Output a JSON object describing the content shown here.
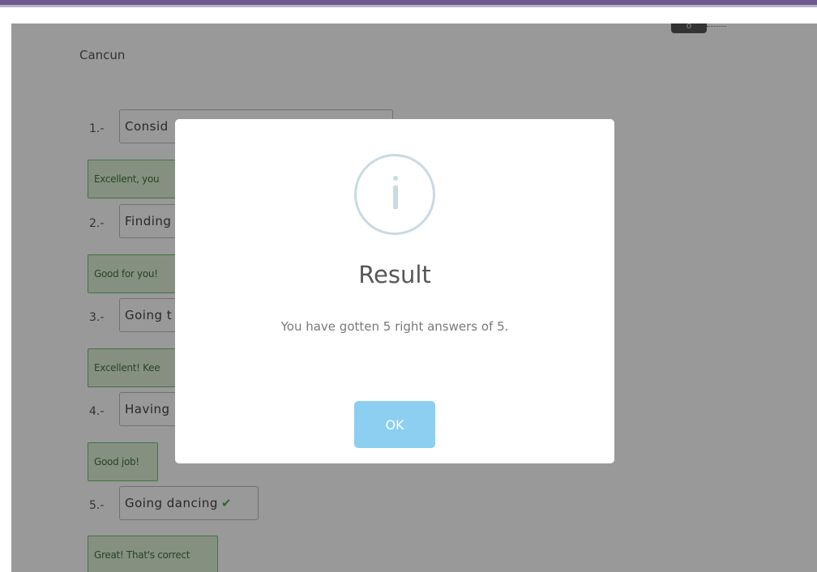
{
  "page": {
    "title": "Cancun"
  },
  "toggle": {
    "label": "o"
  },
  "questions": [
    {
      "num": "1.-",
      "text": "Consid",
      "feedback": "Excellent, you"
    },
    {
      "num": "2.-",
      "text": "Finding",
      "feedback": "Good for you!"
    },
    {
      "num": "3.-",
      "text": "Going t",
      "feedback": "Excellent! Kee"
    },
    {
      "num": "4.-",
      "text": "Having",
      "feedback": "Good job!"
    },
    {
      "num": "5.-",
      "text": "Going dancing",
      "feedback": "Great! That's correct"
    }
  ],
  "modal": {
    "title": "Result",
    "message": "You have gotten 5 right answers of 5.",
    "ok_label": "OK"
  },
  "colors": {
    "header_bar": "#6c5a8e",
    "feedback_bg": "#dff0d8",
    "feedback_border": "#6ec06e",
    "ok_button": "#8ccff0",
    "info_icon": "#c9dae1"
  },
  "icons": {
    "check": "check-icon",
    "info": "info-icon"
  }
}
